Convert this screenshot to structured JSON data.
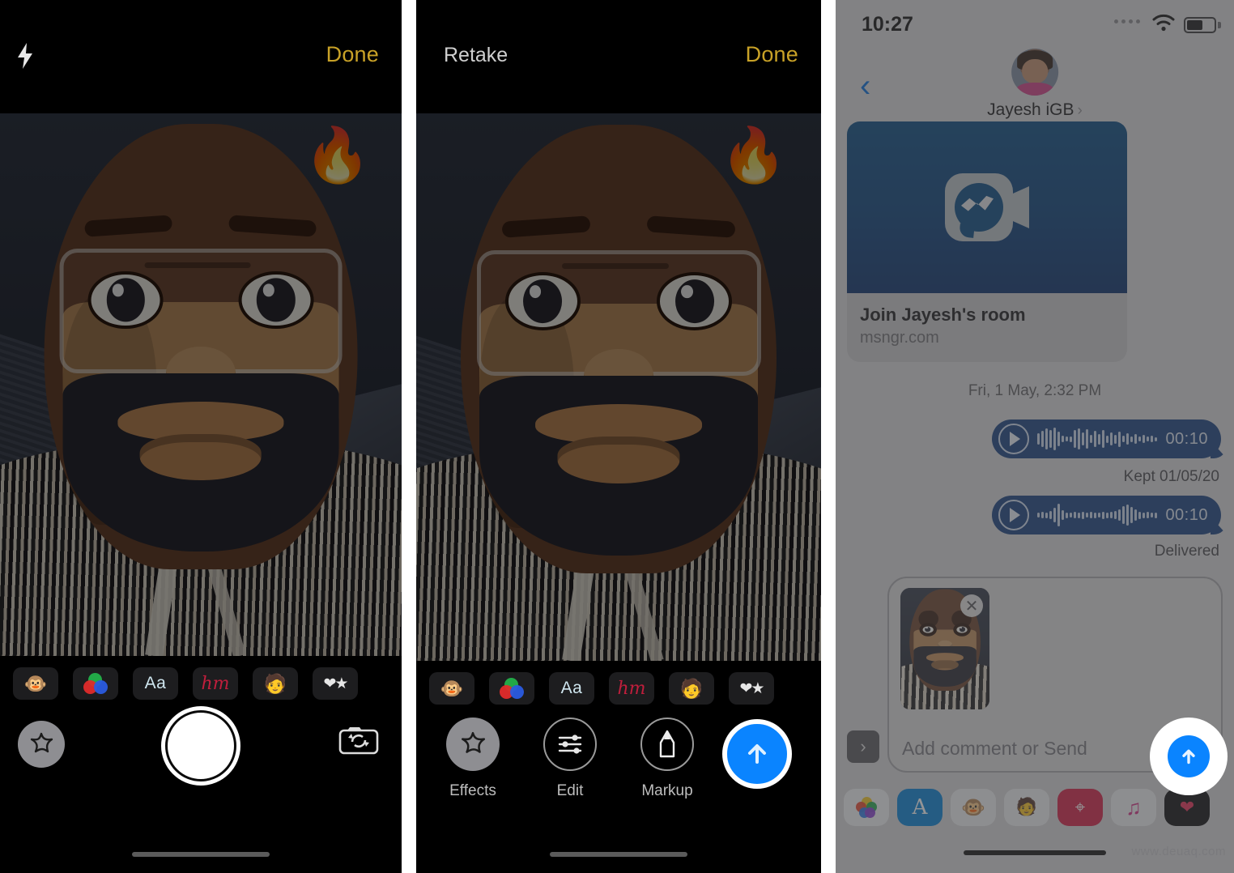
{
  "panel1": {
    "name": "camera-memoji-capture",
    "header": {
      "flash_icon": "flash-icon",
      "done_label": "Done"
    },
    "preview": {
      "sticker": "🔥",
      "sticker_name": "fire-emoji-sticker"
    },
    "effects_tray": [
      {
        "name": "animoji",
        "glyph": "🐵"
      },
      {
        "name": "filters",
        "glyph": ""
      },
      {
        "name": "text",
        "glyph": "Aa"
      },
      {
        "name": "handwriting",
        "glyph": "hm"
      },
      {
        "name": "memoji-stickers",
        "glyph": "🧑"
      },
      {
        "name": "shapes",
        "glyph": "❤★"
      }
    ],
    "controls": {
      "effects_icon": "effects-star-icon",
      "shutter_label": "",
      "flip_icon": "camera-flip-icon"
    }
  },
  "panel2": {
    "name": "photo-preview-actions",
    "header": {
      "retake_label": "Retake",
      "done_label": "Done"
    },
    "preview": {
      "sticker": "🔥"
    },
    "effects_tray": [
      {
        "name": "animoji",
        "glyph": "🐵"
      },
      {
        "name": "filters",
        "glyph": ""
      },
      {
        "name": "text",
        "glyph": "Aa"
      },
      {
        "name": "handwriting",
        "glyph": "hm"
      },
      {
        "name": "memoji-stickers",
        "glyph": "🧑"
      },
      {
        "name": "shapes",
        "glyph": "❤★"
      }
    ],
    "actions": [
      {
        "name": "effects",
        "label": "Effects"
      },
      {
        "name": "edit",
        "label": "Edit"
      },
      {
        "name": "markup",
        "label": "Markup"
      }
    ],
    "send_button": {
      "name": "send-button",
      "icon": "arrow-up-icon"
    }
  },
  "panel3": {
    "name": "messages-conversation",
    "status_bar": {
      "time": "10:27",
      "wifi_icon": "wifi-icon",
      "battery_icon": "battery-icon"
    },
    "nav": {
      "back_icon": "chevron-left-icon",
      "contact_name": "Jayesh iGB",
      "chevron": "›",
      "avatar": "contact-avatar"
    },
    "link_preview": {
      "title": "Join Jayesh's room",
      "url": "msngr.com",
      "icon": "messenger-room-icon"
    },
    "timestamp": "Fri, 1 May, 2:32 PM",
    "audio_messages": [
      {
        "duration": "00:10",
        "receipt": "Kept 01/05/20"
      },
      {
        "duration": "00:10",
        "receipt": "Delivered"
      }
    ],
    "input": {
      "expand_icon": "chevron-right-icon",
      "attachment_close_icon": "close-icon",
      "placeholder": "Add comment or Send",
      "send_icon": "arrow-up-icon"
    },
    "app_drawer": [
      {
        "name": "photos",
        "glyph": ""
      },
      {
        "name": "app-store",
        "glyph": "A"
      },
      {
        "name": "animoji",
        "glyph": "🐵"
      },
      {
        "name": "memoji-stickers",
        "glyph": "🧑"
      },
      {
        "name": "images-search",
        "glyph": "⌖"
      },
      {
        "name": "music",
        "glyph": "♫"
      },
      {
        "name": "digital-touch",
        "glyph": "❤"
      }
    ]
  },
  "watermark": "www.deuaq.com",
  "colors": {
    "accent_yellow": "#c9a227",
    "accent_blue": "#0a84ff",
    "bubble_blue": "#1c4480",
    "link_blue": "#0b4a80"
  }
}
